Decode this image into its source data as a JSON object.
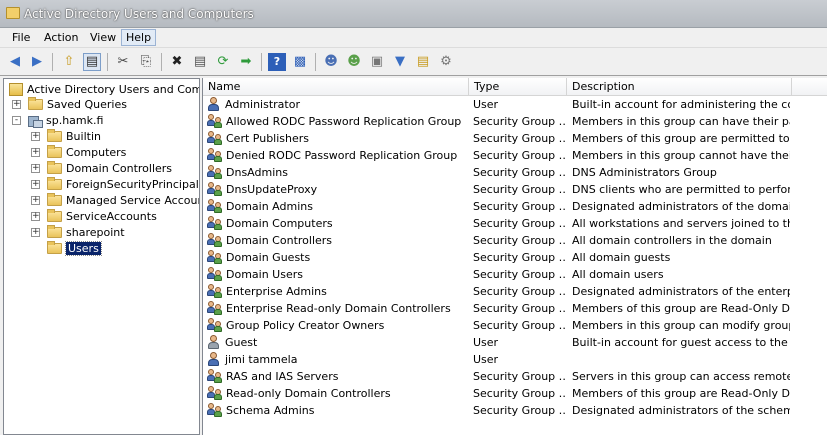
{
  "window": {
    "title": "Active Directory Users and Computers"
  },
  "menu": [
    "File",
    "Action",
    "View",
    "Help"
  ],
  "toolbar": [
    "back-icon",
    "forward-icon",
    "up-folder-icon",
    "show-tree-icon",
    "cut-icon",
    "copy-icon",
    "delete-icon",
    "properties-icon",
    "refresh-icon",
    "export-icon",
    "help-icon",
    "show-pane-icon",
    "new-user-icon",
    "new-group-icon",
    "new-ou-icon",
    "filter-icon",
    "add-to-group-icon",
    "delegate-icon"
  ],
  "tree": {
    "root": "Active Directory Users and Comput",
    "items": [
      {
        "label": "Saved Queries",
        "level": 1,
        "expander": "+"
      },
      {
        "label": "sp.hamk.fi",
        "level": 1,
        "expander": "-"
      },
      {
        "label": "Builtin",
        "level": 2,
        "expander": "+"
      },
      {
        "label": "Computers",
        "level": 2,
        "expander": "+"
      },
      {
        "label": "Domain Controllers",
        "level": 2,
        "expander": "+"
      },
      {
        "label": "ForeignSecurityPrincipals",
        "level": 2,
        "expander": "+"
      },
      {
        "label": "Managed Service Accounts",
        "level": 2,
        "expander": "+"
      },
      {
        "label": "ServiceAccounts",
        "level": 2,
        "expander": "+"
      },
      {
        "label": "sharepoint",
        "level": 2,
        "expander": "+"
      },
      {
        "label": "Users",
        "level": 2,
        "expander": "",
        "selected": true
      }
    ]
  },
  "list": {
    "columns": {
      "name": "Name",
      "type": "Type",
      "description": "Description"
    },
    "rows": [
      {
        "name": "Administrator",
        "type": "User",
        "description": "Built-in account for administering the com…",
        "icon": "user"
      },
      {
        "name": "Allowed RODC Password Replication Group",
        "type": "Security Group …",
        "description": "Members in this group can have their pas…",
        "icon": "group"
      },
      {
        "name": "Cert Publishers",
        "type": "Security Group …",
        "description": "Members of this group are permitted to p…",
        "icon": "group"
      },
      {
        "name": "Denied RODC Password Replication Group",
        "type": "Security Group …",
        "description": "Members in this group cannot have their …",
        "icon": "group"
      },
      {
        "name": "DnsAdmins",
        "type": "Security Group …",
        "description": "DNS Administrators Group",
        "icon": "group"
      },
      {
        "name": "DnsUpdateProxy",
        "type": "Security Group …",
        "description": "DNS clients who are permitted to perform …",
        "icon": "group"
      },
      {
        "name": "Domain Admins",
        "type": "Security Group …",
        "description": "Designated administrators of the domain",
        "icon": "group"
      },
      {
        "name": "Domain Computers",
        "type": "Security Group …",
        "description": "All workstations and servers joined to the…",
        "icon": "group"
      },
      {
        "name": "Domain Controllers",
        "type": "Security Group …",
        "description": "All domain controllers in the domain",
        "icon": "group"
      },
      {
        "name": "Domain Guests",
        "type": "Security Group …",
        "description": "All domain guests",
        "icon": "group"
      },
      {
        "name": "Domain Users",
        "type": "Security Group …",
        "description": "All domain users",
        "icon": "group"
      },
      {
        "name": "Enterprise Admins",
        "type": "Security Group …",
        "description": "Designated administrators of the enterprise",
        "icon": "group"
      },
      {
        "name": "Enterprise Read-only Domain Controllers",
        "type": "Security Group …",
        "description": "Members of this group are Read-Only Do…",
        "icon": "group"
      },
      {
        "name": "Group Policy Creator Owners",
        "type": "Security Group …",
        "description": "Members in this group can modify group p…",
        "icon": "group"
      },
      {
        "name": "Guest",
        "type": "User",
        "description": "Built-in account for guest access to the co…",
        "icon": "guest"
      },
      {
        "name": "jimi tammela",
        "type": "User",
        "description": "",
        "icon": "user"
      },
      {
        "name": "RAS and IAS Servers",
        "type": "Security Group …",
        "description": "Servers in this group can access remote a…",
        "icon": "group"
      },
      {
        "name": "Read-only Domain Controllers",
        "type": "Security Group …",
        "description": "Members of this group are Read-Only Do…",
        "icon": "group"
      },
      {
        "name": "Schema Admins",
        "type": "Security Group …",
        "description": "Designated administrators of the schema",
        "icon": "group"
      }
    ]
  }
}
